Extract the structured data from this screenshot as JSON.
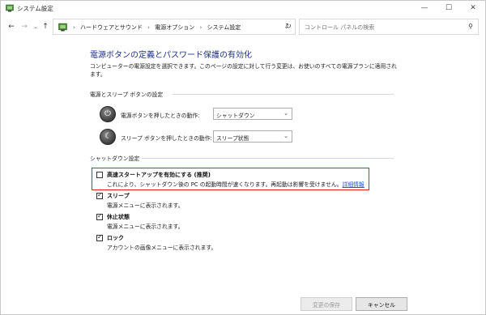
{
  "window": {
    "title": "システム設定",
    "buttons": {
      "minimize": "—",
      "maximize": "☐",
      "close": "✕"
    }
  },
  "nav": {
    "back": "←",
    "forward": "→",
    "up": "↑",
    "breadcrumb": [
      "ハードウェアとサウンド",
      "電源オプション",
      "システム設定"
    ],
    "refresh": "↻",
    "search_placeholder": "コントロール パネルの検索"
  },
  "page": {
    "heading": "電源ボタンの定義とパスワード保護の有効化",
    "description": "コンピューターの電源設定を選択できます。このページの設定に対して行う変更は、お使いのすべての電源プランに適用されます。"
  },
  "power_buttons": {
    "section_title": "電源とスリープ ボタンの設定",
    "rows": [
      {
        "label": "電源ボタンを押したときの動作:",
        "value": "シャットダウン"
      },
      {
        "label": "スリープ ボタンを押したときの動作:",
        "value": "スリープ状態"
      }
    ]
  },
  "shutdown": {
    "section_title": "シャットダウン設定",
    "items": [
      {
        "title": "高速スタートアップを有効にする (推奨)",
        "desc": "これにより、シャットダウン後の PC の起動時間が速くなります。再起動は影響を受けません。",
        "link": "詳細情報",
        "checked": false
      },
      {
        "title": "スリープ",
        "desc": "電源メニューに表示されます。",
        "checked": true
      },
      {
        "title": "休止状態",
        "desc": "電源メニューに表示されます。",
        "checked": true
      },
      {
        "title": "ロック",
        "desc": "アカウントの画像メニューに表示されます。",
        "checked": true
      }
    ]
  },
  "footer": {
    "save": "変更の保存",
    "cancel": "キャンセル"
  },
  "colors": {
    "heading": "#1e3287",
    "highlight_border": "#e0221f",
    "link": "#1a57c8"
  }
}
